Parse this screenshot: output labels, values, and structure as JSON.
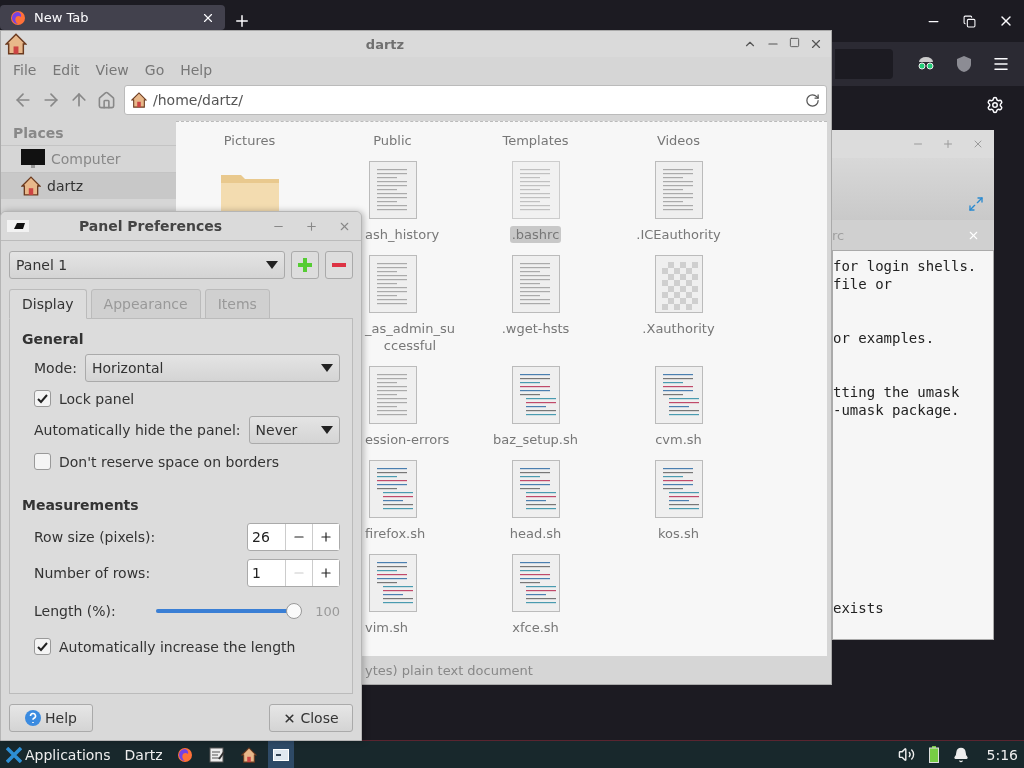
{
  "browser": {
    "tabs": [
      {
        "title": "New Tab",
        "selected": true
      }
    ]
  },
  "text_editor": {
    "tab": "rc",
    "lines": [
      {
        "kind": "text",
        "text": "for login shells."
      },
      {
        "kind": "text",
        "text": "file or"
      },
      {
        "kind": "blank"
      },
      {
        "kind": "blank"
      },
      {
        "kind": "text",
        "text": "or examples."
      },
      {
        "kind": "blank"
      },
      {
        "kind": "blank"
      },
      {
        "kind": "text",
        "text": "tting the umask"
      },
      {
        "kind": "text",
        "text": "-umask package."
      },
      {
        "kind": "blank"
      },
      {
        "kind": "blank"
      },
      {
        "kind": "blank"
      },
      {
        "kind": "blank"
      },
      {
        "kind": "blank"
      },
      {
        "kind": "blank"
      },
      {
        "kind": "blank"
      },
      {
        "kind": "blank"
      },
      {
        "kind": "blank"
      },
      {
        "kind": "blank"
      },
      {
        "kind": "text",
        "text": "exists"
      }
    ]
  },
  "file_manager": {
    "title": "dartz",
    "menu": [
      "File",
      "Edit",
      "View",
      "Go",
      "Help"
    ],
    "location": "/home/dartz/",
    "sidebar": {
      "heading": "Places",
      "items": [
        {
          "label": "Computer",
          "kind": "computer",
          "selected": false
        },
        {
          "label": "dartz",
          "kind": "home",
          "selected": true
        }
      ]
    },
    "icon_view": {
      "columns": [
        [
          {
            "label": "Pictures",
            "selected": false
          },
          {
            "kind": "folder",
            "selected": false
          }
        ],
        [
          {
            "label": "Public",
            "selected": false
          },
          {
            "label": "ash_history",
            "kind": "text",
            "selected": false
          },
          {
            "label": "_as_admin_su\nccessful",
            "kind": "text",
            "selected": false
          },
          {
            "label": "ession-errors",
            "kind": "text",
            "selected": false
          },
          {
            "label": "firefox.sh",
            "kind": "script",
            "selected": false
          },
          {
            "label": "vim.sh",
            "kind": "script",
            "selected": false
          }
        ],
        [
          {
            "label": "Templates",
            "selected": false
          },
          {
            "label": ".bashrc",
            "kind": "text",
            "selected": true
          },
          {
            "label": ".wget-hsts",
            "kind": "text",
            "selected": false
          },
          {
            "label": "baz_setup.sh",
            "kind": "script",
            "selected": false
          },
          {
            "label": "head.sh",
            "kind": "script",
            "selected": false
          },
          {
            "label": "xfce.sh",
            "kind": "script",
            "selected": false
          }
        ],
        [
          {
            "label": "Videos",
            "selected": false
          },
          {
            "label": ".ICEauthority",
            "kind": "text",
            "selected": false
          },
          {
            "label": ".Xauthority",
            "kind": "image",
            "selected": false
          },
          {
            "label": "cvm.sh",
            "kind": "script",
            "selected": false
          },
          {
            "label": "kos.sh",
            "kind": "script",
            "selected": false
          }
        ]
      ]
    },
    "status": "ytes) plain text document"
  },
  "dialog": {
    "title": "Panel Preferences",
    "panel": "Panel 1",
    "tabs": [
      {
        "label": "Display",
        "selected": true
      },
      {
        "label": "Appearance",
        "selected": false
      },
      {
        "label": "Items",
        "selected": false
      }
    ],
    "general": {
      "heading": "General",
      "mode_label": "Mode:",
      "mode": "Horizontal",
      "lock": {
        "label": "Lock panel",
        "checked": true
      },
      "autohide_label": "Automatically hide the panel:",
      "autohide": "Never",
      "reserve": {
        "label": "Don't reserve space on borders",
        "checked": false
      }
    },
    "measurements": {
      "heading": "Measurements",
      "spins": [
        {
          "label": "Row size (pixels):",
          "value": "26",
          "minus_disabled": false
        },
        {
          "label": "Number of rows:",
          "value": "1",
          "minus_disabled": true
        }
      ],
      "length": {
        "label": "Length (%):",
        "level": 1.0,
        "reading": "100"
      },
      "auto_length": {
        "label": "Automatically increase the length",
        "checked": true
      }
    },
    "buttons": [
      {
        "label": "Help",
        "kind": "help"
      },
      {
        "label": "Close",
        "kind": "close"
      }
    ]
  },
  "taskbar": {
    "menu": "Applications",
    "task": "Dartz",
    "launchers": [
      {
        "kind": "browser",
        "selected": false
      },
      {
        "kind": "editor",
        "selected": false
      },
      {
        "kind": "home",
        "selected": false
      },
      {
        "kind": "window",
        "selected": true
      }
    ],
    "clock": "5:16"
  }
}
